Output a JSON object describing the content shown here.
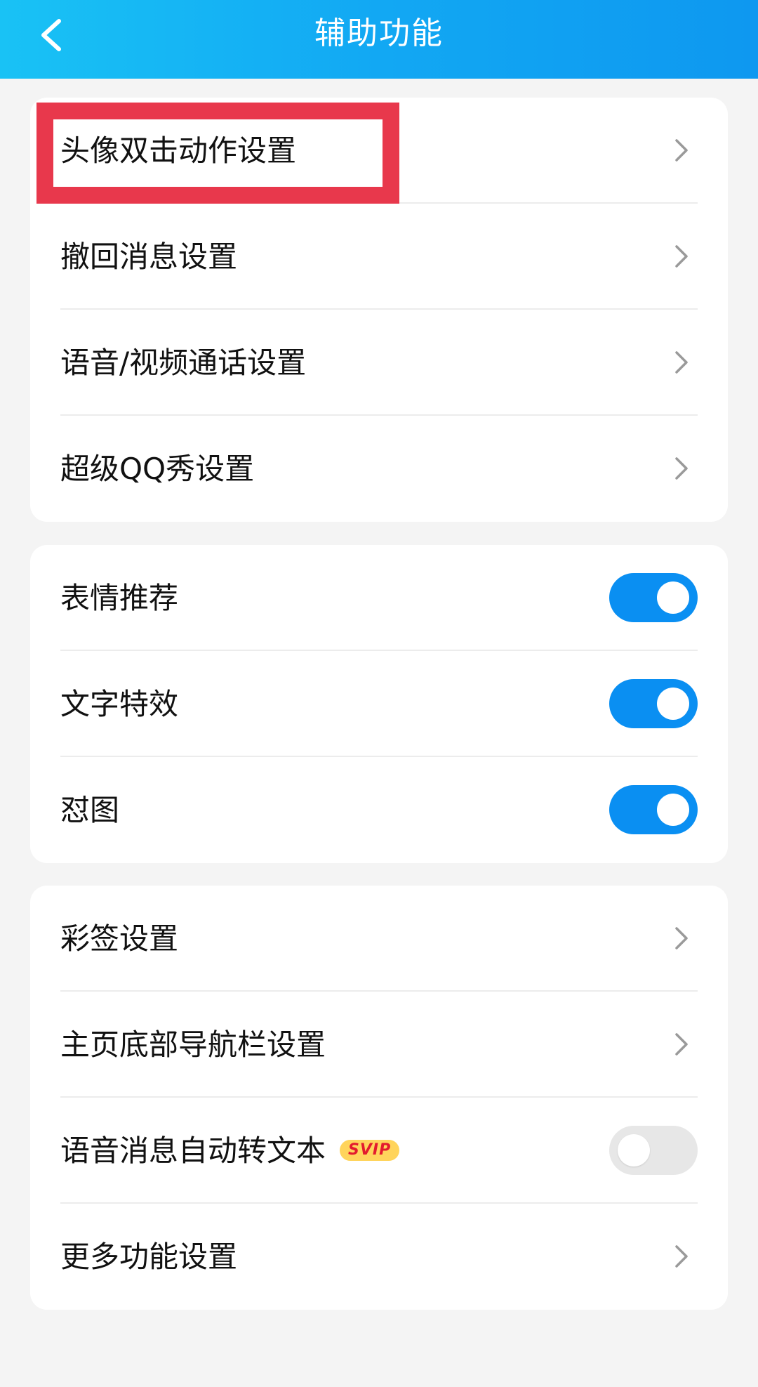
{
  "header": {
    "title": "辅助功能",
    "back_icon": "chevron-left-icon",
    "gradient": [
      "#19c2f5",
      "#0e98f0"
    ]
  },
  "groups": [
    {
      "items": [
        {
          "label": "头像双击动作设置",
          "type": "link"
        },
        {
          "label": "撤回消息设置",
          "type": "link"
        },
        {
          "label": "语音/视频通话设置",
          "type": "link"
        },
        {
          "label": "超级QQ秀设置",
          "type": "link"
        }
      ]
    },
    {
      "items": [
        {
          "label": "表情推荐",
          "type": "toggle",
          "state": "on"
        },
        {
          "label": "文字特效",
          "type": "toggle",
          "state": "on"
        },
        {
          "label": "怼图",
          "type": "toggle",
          "state": "on"
        }
      ]
    },
    {
      "items": [
        {
          "label": "彩签设置",
          "type": "link"
        },
        {
          "label": "主页底部导航栏设置",
          "type": "link"
        },
        {
          "label": "语音消息自动转文本",
          "type": "toggle",
          "state": "off",
          "badge": "SVIP"
        },
        {
          "label": "更多功能设置",
          "type": "link"
        }
      ]
    }
  ],
  "colors": {
    "accent": "#0a8ff2",
    "highlight": "#e8384c",
    "badge_bg": "#ffd45c",
    "badge_text": "#e31b2e"
  }
}
